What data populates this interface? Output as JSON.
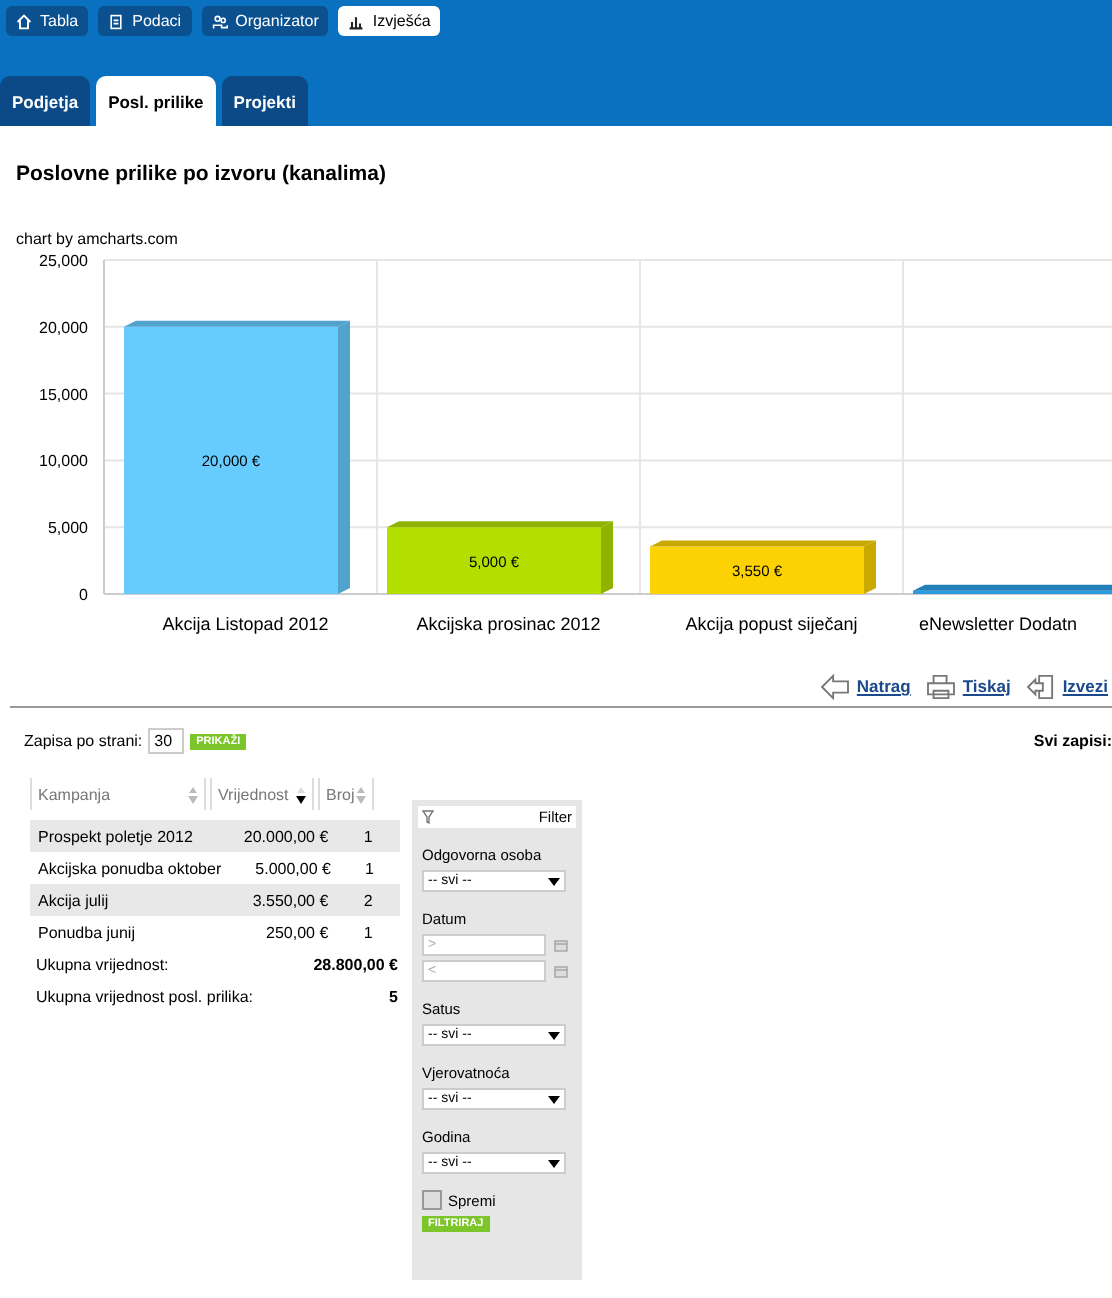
{
  "top_nav": [
    {
      "label": "Tabla",
      "kind": "home",
      "selected": false
    },
    {
      "label": "Podaci",
      "kind": "doc",
      "selected": false
    },
    {
      "label": "Organizator",
      "kind": "people",
      "selected": false
    },
    {
      "label": "Izvješća",
      "kind": "chart",
      "selected": true
    }
  ],
  "tabs": [
    {
      "label": "Podjetja",
      "selected": false
    },
    {
      "label": "Posl. prilike",
      "selected": true
    },
    {
      "label": "Projekti",
      "selected": false
    }
  ],
  "title": "Poslovne prilike po izvoru (kanalima)",
  "chart_credit": "chart by amcharts.com",
  "chart_data": {
    "type": "bar",
    "categories": [
      "Akcija Listopad 2012",
      "Akcijska prosinac 2012",
      "Akcija popust siječanj",
      "eNewsletter Dodatn"
    ],
    "series": [
      {
        "values": [
          20000,
          5000,
          3550,
          250
        ]
      }
    ],
    "grid": true,
    "ylim": [
      0,
      25000
    ],
    "yticks": [
      {
        "value": 0,
        "label": "0"
      },
      {
        "value": 5000,
        "label": "5,000"
      },
      {
        "value": 10000,
        "label": "10,000"
      },
      {
        "value": 15000,
        "label": "15,000"
      },
      {
        "value": 20000,
        "label": "20,000"
      },
      {
        "value": 25000,
        "label": "25,000"
      }
    ],
    "value_labels": [
      "20,000 €",
      "5,000 €",
      "3,550 €",
      null
    ]
  },
  "actions": [
    {
      "label": "Natrag",
      "kind": "back"
    },
    {
      "label": "Tiskaj",
      "kind": "print"
    },
    {
      "label": "Izvezi",
      "kind": "export"
    }
  ],
  "paging": {
    "label": "Zapisa po strani:",
    "value": "30",
    "button": "PRIKAŽI",
    "total_label": "Svi zapisi:"
  },
  "table": {
    "columns": [
      {
        "label": "Kampanja",
        "sorted": false
      },
      {
        "label": "Vrijednost",
        "sorted": true
      },
      {
        "label": "Broj",
        "sorted": false
      }
    ],
    "rows": [
      [
        "Prospekt poletje 2012",
        "20.000,00 €",
        "1"
      ],
      [
        "Akcijska ponudba oktober",
        "5.000,00 €",
        "1"
      ],
      [
        "Akcija julij",
        "3.550,00 €",
        "2"
      ],
      [
        "Ponudba junij",
        "250,00 €",
        "1"
      ]
    ],
    "totals": [
      {
        "label": "Ukupna vrijednost:",
        "value": "28.800,00 €"
      },
      {
        "label": "Ukupna vrijednost posl. prilika:",
        "value": "5"
      }
    ]
  },
  "filter": {
    "title": "Filter",
    "fields": [
      {
        "kind": "select",
        "label": "Odgovorna osoba",
        "value": "-- svi --"
      },
      {
        "kind": "dates",
        "label": "Datum",
        "from_placeholder": ">",
        "to_placeholder": "<"
      },
      {
        "kind": "select",
        "label": "Satus",
        "value": "-- svi --"
      },
      {
        "kind": "select",
        "label": "Vjerovatnoća",
        "value": "-- svi --"
      },
      {
        "kind": "select",
        "label": "Godina",
        "value": "-- svi --"
      }
    ],
    "save": {
      "label": "Spremi",
      "checked": false
    },
    "button": "FILTRIRAJ"
  }
}
